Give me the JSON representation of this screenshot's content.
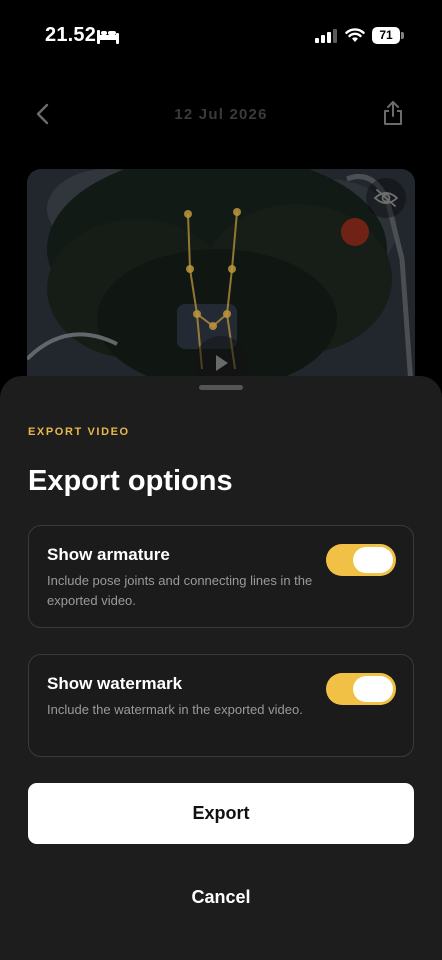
{
  "status_bar": {
    "time": "21.52",
    "battery_level": "71",
    "icons": [
      "bed-icon",
      "cellular-signal-icon",
      "wifi-icon",
      "battery-icon"
    ]
  },
  "header": {
    "date": "12 Jul 2026",
    "back_icon": "chevron-left-icon",
    "share_icon": "share-icon"
  },
  "video": {
    "visibility_icon": "eye-slash-icon",
    "play_icon": "play-icon",
    "armature_color": "#e8b84a"
  },
  "sheet": {
    "kicker": "EXPORT VIDEO",
    "title": "Export options",
    "options": [
      {
        "title": "Show armature",
        "description": "Include pose joints and connecting lines in the exported video.",
        "enabled": true
      },
      {
        "title": "Show watermark",
        "description": "Include the watermark in the exported video.",
        "enabled": true
      }
    ],
    "export_label": "Export",
    "cancel_label": "Cancel",
    "accent_color": "#f0c144"
  }
}
